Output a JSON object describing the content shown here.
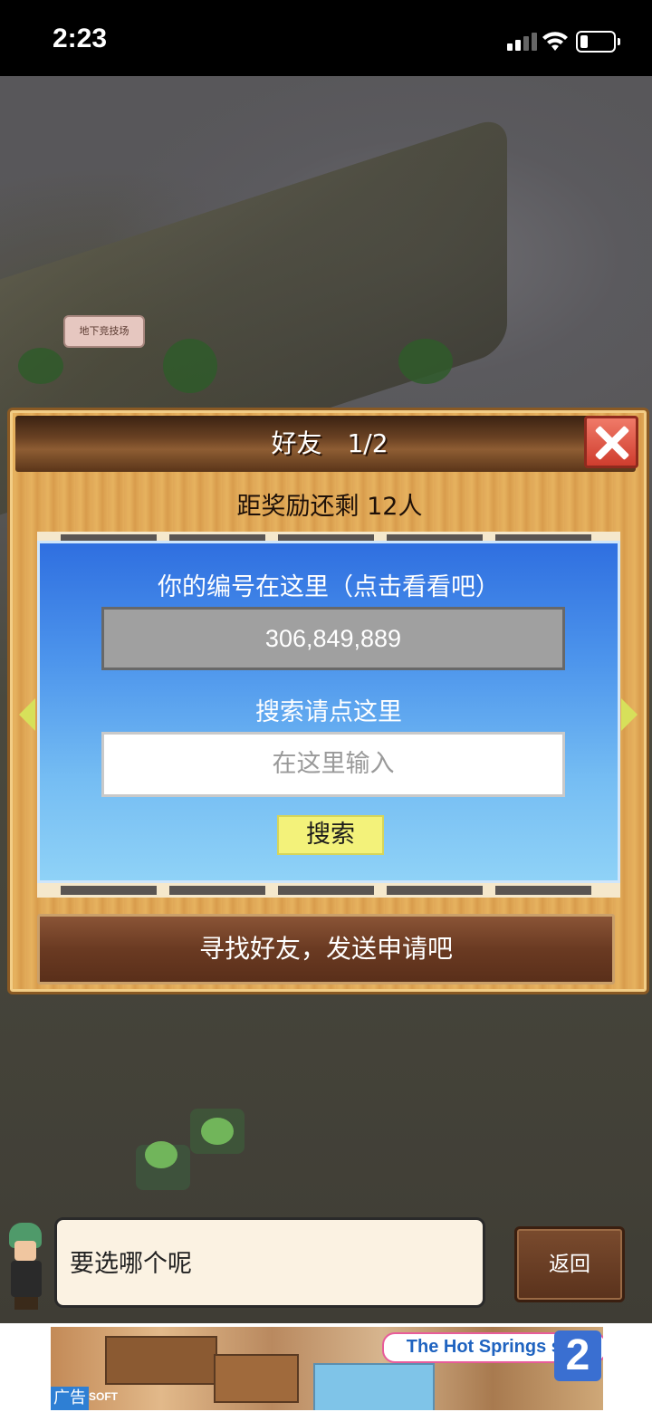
{
  "status_bar": {
    "time": "2:23"
  },
  "map": {
    "arena_sign": "地下竞技场"
  },
  "dialog": {
    "title": "好友　1/2",
    "reward_text": "距奖励还剩 12人",
    "id_label": "你的编号在这里（点击看看吧）",
    "id_value": "306,849,889",
    "search_label": "搜索请点这里",
    "search_placeholder": "在这里输入",
    "search_button": "搜索",
    "find_friends_button": "寻找好友，发送申请吧"
  },
  "chat": {
    "message": "要选哪个呢",
    "back_button": "返回"
  },
  "ad": {
    "label": "广告",
    "title": "The Hot Springs sim",
    "number": "2",
    "brand": "SOFT"
  },
  "colors": {
    "panel_blue": "#4d95ec",
    "search_button": "#f3f27a",
    "close_red": "#cf3d2e"
  }
}
